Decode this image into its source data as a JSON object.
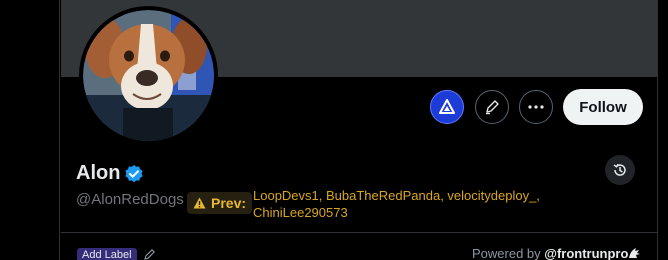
{
  "profile": {
    "display_name": "Alon",
    "handle": "@AlonRedDogs",
    "verified": true,
    "prev_label": "Prev:",
    "previous_names": "LoopDevs1, BubaTheRedPanda, velocitydeploy_, ChiniLee290573"
  },
  "actions": {
    "follow_label": "Follow"
  },
  "footer": {
    "add_label": "Add Label",
    "powered_by": "Powered by ",
    "brand": "@frontrunpro"
  },
  "colors": {
    "accent_blue": "#1d9bf0",
    "prev_gold": "#d9a621",
    "frontrun_blue": "#1d3bd6",
    "label_purple": "#352c7a"
  },
  "icons": [
    "frontrun-logo-icon",
    "edit-icon",
    "more-icon",
    "history-icon",
    "verified-icon",
    "warning-icon",
    "pencil-icon",
    "frontrun-dragon-icon"
  ]
}
